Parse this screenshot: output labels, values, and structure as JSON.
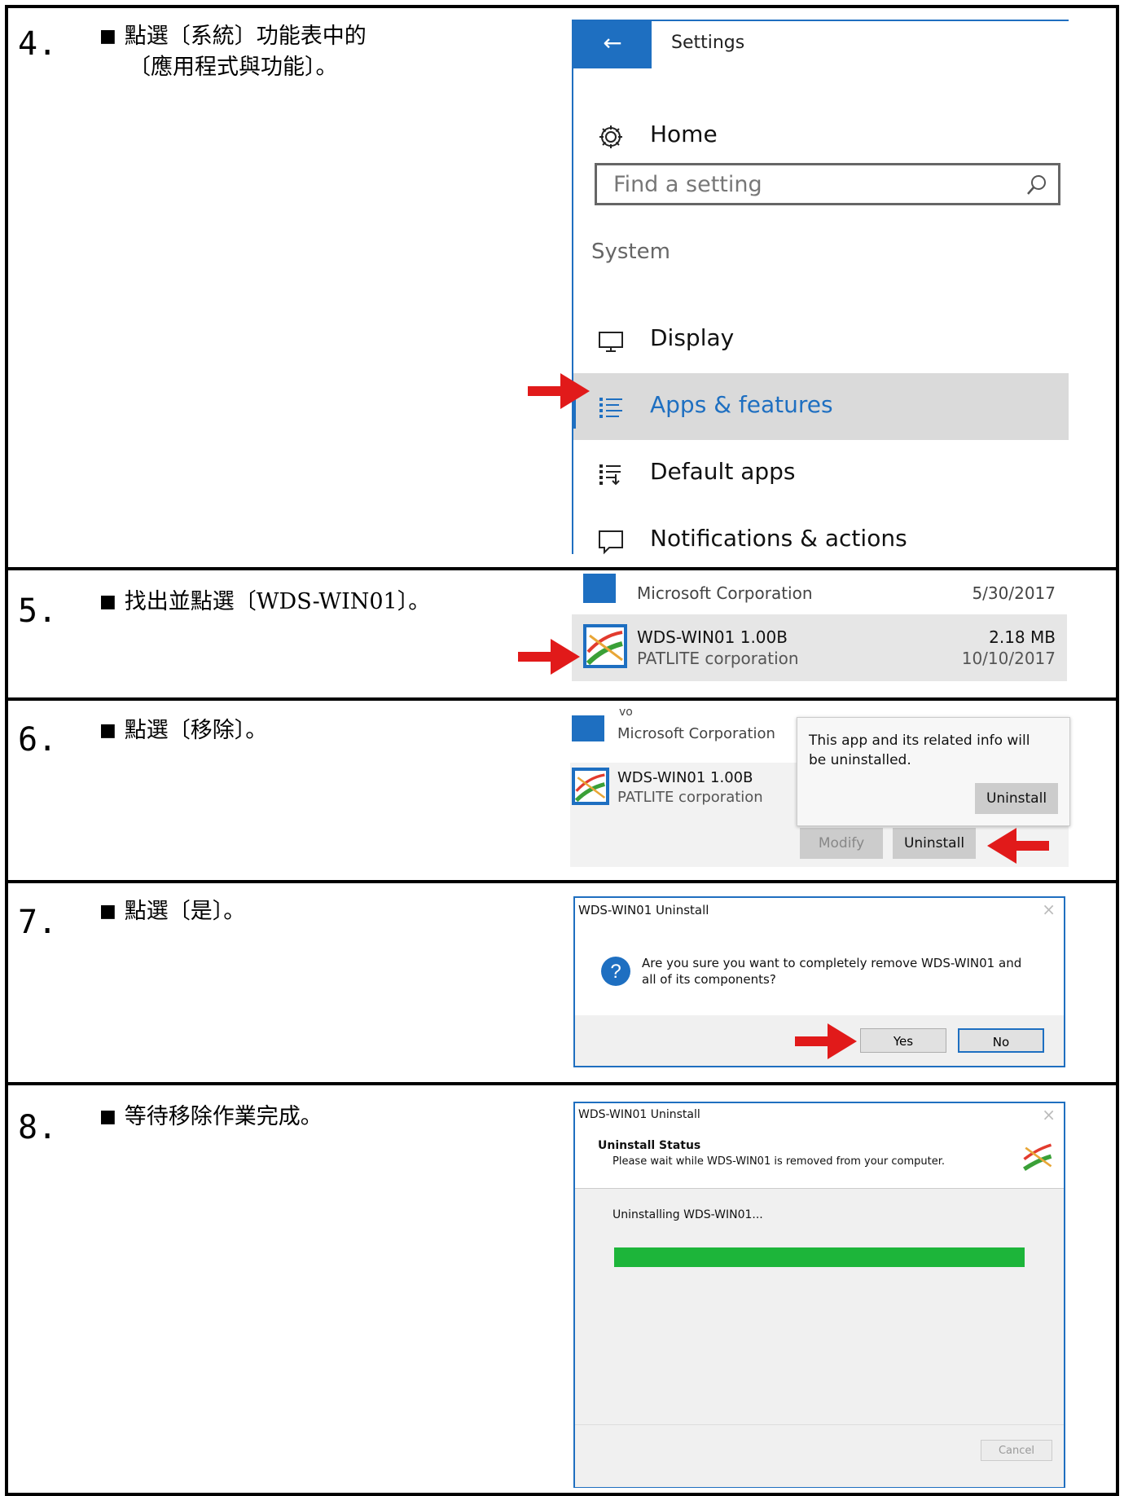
{
  "steps": [
    {
      "number": "4.",
      "bullet": "■",
      "text_line1": "點選〔系統〕功能表中的",
      "text_line2": "〔應用程式與功能〕。"
    },
    {
      "number": "5.",
      "bullet": "■",
      "text": "找出並點選〔WDS-WIN01〕。"
    },
    {
      "number": "6.",
      "bullet": "■",
      "text": "點選〔移除〕。"
    },
    {
      "number": "7.",
      "bullet": "■",
      "text": "點選〔是〕。"
    },
    {
      "number": "8.",
      "bullet": "■",
      "text": "等待移除作業完成。"
    }
  ],
  "settings": {
    "back_icon": "←",
    "title": "Settings",
    "home_label": "Home",
    "search_placeholder": "Find a setting",
    "section_label": "System",
    "items": [
      "Display",
      "Apps & features",
      "Default apps",
      "Notifications & actions"
    ],
    "selected_item": "Apps & features",
    "accent_color": "#1e6fc1"
  },
  "step5_list": {
    "prev_publisher": "Microsoft Corporation",
    "prev_date": "5/30/2017",
    "app_name": "WDS-WIN01 1.00B",
    "app_size": "2.18 MB",
    "app_publisher": "PATLITE corporation",
    "app_date": "10/10/2017"
  },
  "step6": {
    "prev_title": "vo",
    "prev_publisher": "Microsoft Corporation",
    "app_name": "WDS-WIN01 1.00B",
    "app_publisher": "PATLITE corporation",
    "popup_text": "This app and its related info will be uninstalled.",
    "popup_button": "Uninstall",
    "modify_button": "Modify",
    "uninstall_button": "Uninstall"
  },
  "step7": {
    "title": "WDS-WIN01 Uninstall",
    "message": "Are you sure you want to completely remove WDS-WIN01 and all of its components?",
    "yes_button": "Yes",
    "no_button": "No",
    "close_icon": "×"
  },
  "step8": {
    "title": "WDS-WIN01 Uninstall",
    "status_heading": "Uninstall Status",
    "status_sub": "Please wait while WDS-WIN01 is removed from your computer.",
    "progress_text": "Uninstalling WDS-WIN01...",
    "progress_fraction": 1.0,
    "progress_color": "#1db53a",
    "cancel_button": "Cancel",
    "close_icon": "×"
  }
}
